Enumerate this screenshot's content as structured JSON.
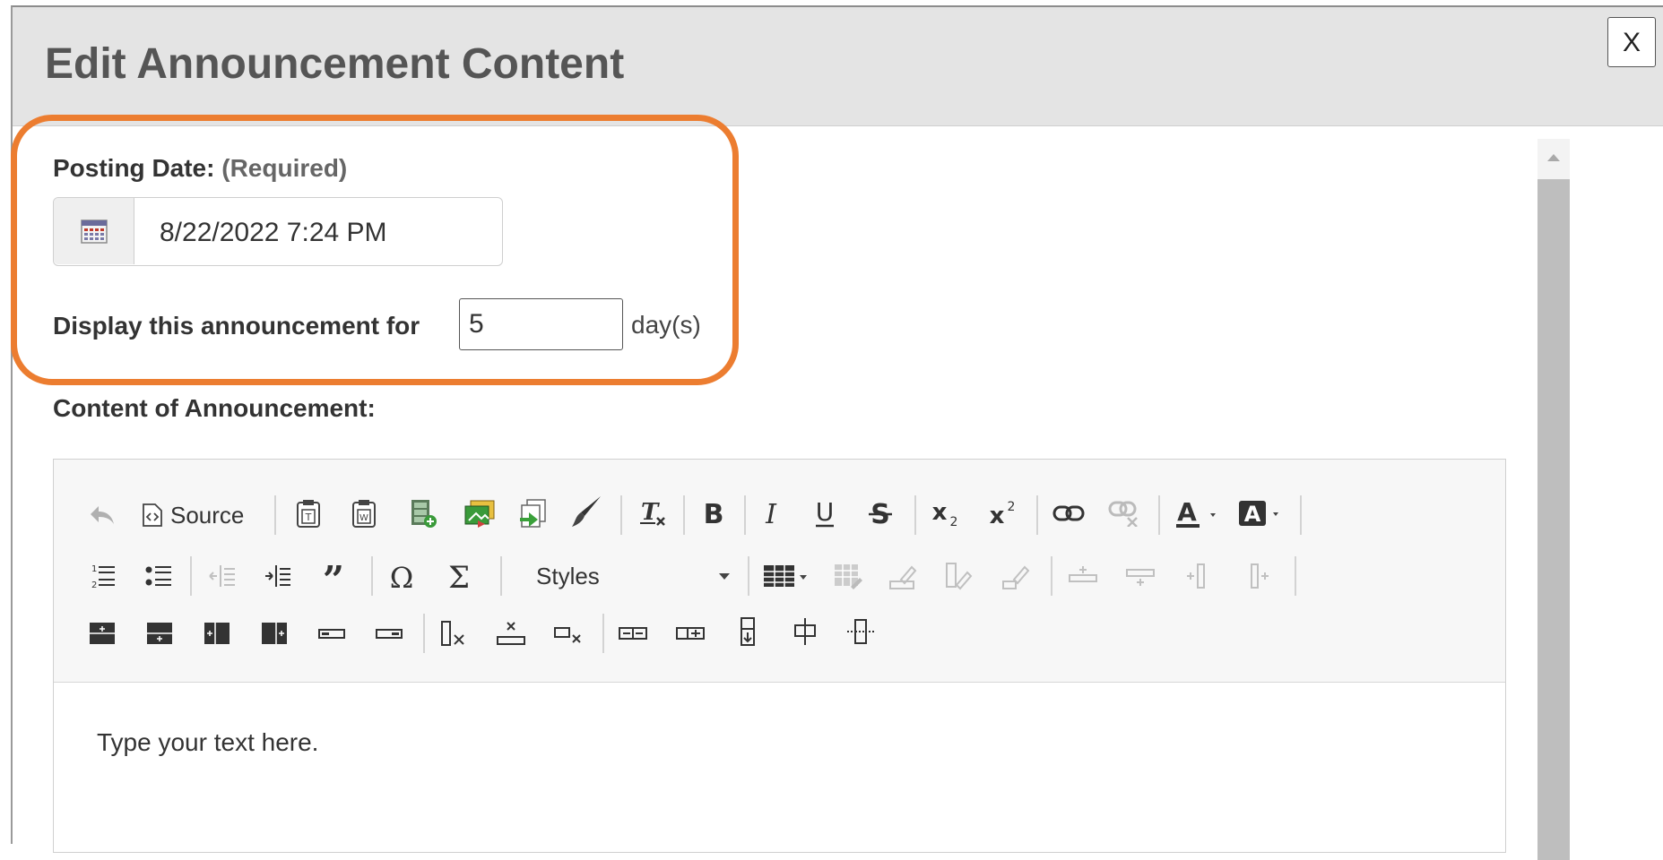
{
  "dialog": {
    "title": "Edit Announcement Content",
    "close_label": "X"
  },
  "form": {
    "posting_date_label": "Posting Date:",
    "posting_date_required": "(Required)",
    "posting_date_value": "8/22/2022 7:24 PM",
    "display_label": "Display this announcement for",
    "display_days_value": "5",
    "display_unit": "day(s)",
    "content_label": "Content of Announcement:"
  },
  "editor": {
    "source_label": "Source",
    "styles_label": "Styles",
    "placeholder_text": "Type your text here.",
    "toolbar_row1": [
      "undo-icon",
      "source-icon",
      "paste-text-icon",
      "paste-word-icon",
      "image-icon",
      "flash-icon",
      "templates-icon",
      "format-brush-icon",
      "remove-format-icon",
      "bold-icon",
      "italic-icon",
      "underline-icon",
      "strikethrough-icon",
      "subscript-icon",
      "superscript-icon",
      "link-icon",
      "unlink-icon",
      "text-color-icon",
      "background-color-icon"
    ],
    "toolbar_row2": [
      "numbered-list-icon",
      "bulleted-list-icon",
      "decrease-indent-icon",
      "increase-indent-icon",
      "blockquote-icon",
      "special-char-icon",
      "formula-icon",
      "styles-dropdown",
      "table-icon",
      "table-properties-icon",
      "cell-properties-icon",
      "cell-merge-icon",
      "cell-split-icon",
      "row-insert-before-icon",
      "row-insert-after-icon",
      "column-insert-before-icon",
      "column-insert-after-icon"
    ],
    "toolbar_row3": [
      "row-before-icon",
      "row-after-icon",
      "column-before-icon",
      "column-after-icon",
      "cell-before-icon",
      "cell-after-icon",
      "delete-column-icon",
      "delete-row-icon",
      "delete-cell-icon",
      "merge-cells-icon",
      "merge-right-icon",
      "merge-down-icon",
      "split-horizontal-icon",
      "split-vertical-icon"
    ]
  },
  "colors": {
    "highlight": "#ec7d30",
    "titlebar": "#e4e4e4",
    "scroll_thumb": "#bebebe"
  }
}
